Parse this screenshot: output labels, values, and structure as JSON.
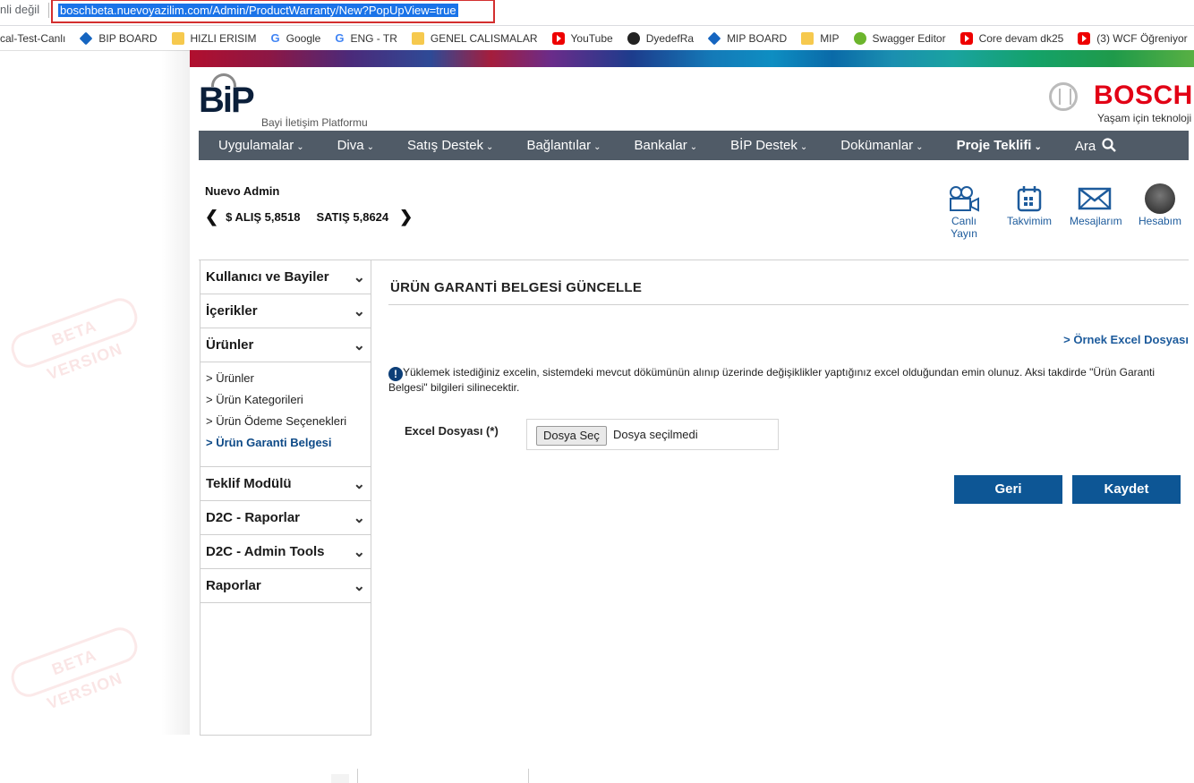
{
  "browser": {
    "secure_text": "nli değil",
    "url": "boschbeta.nuevoyazilim.com/Admin/ProductWarranty/New?PopUpView=true"
  },
  "bookmarks": [
    {
      "label": "cal-Test-Canlı",
      "icon": "none"
    },
    {
      "label": "BIP BOARD",
      "icon": "diamond-icon"
    },
    {
      "label": "HIZLI ERISIM",
      "icon": "folder-icon"
    },
    {
      "label": "Google",
      "icon": "google-icon"
    },
    {
      "label": "ENG - TR",
      "icon": "google-icon"
    },
    {
      "label": "GENEL CALISMALAR",
      "icon": "folder-icon"
    },
    {
      "label": "YouTube",
      "icon": "youtube-icon"
    },
    {
      "label": "DyedefRa",
      "icon": "github-icon"
    },
    {
      "label": "MIP BOARD",
      "icon": "diamond-icon"
    },
    {
      "label": "MIP",
      "icon": "folder-icon"
    },
    {
      "label": "Swagger Editor",
      "icon": "swagger-icon"
    },
    {
      "label": "Core devam dk25",
      "icon": "youtube-icon"
    },
    {
      "label": "(3) WCF Öğreniyor",
      "icon": "youtube-icon"
    }
  ],
  "brand": {
    "logo": "BiP",
    "subtitle": "Bayi İletişim Platformu",
    "bosch_name": "BOSCH",
    "bosch_tagline": "Yaşam için teknoloji"
  },
  "nav": {
    "items": [
      "Uygulamalar",
      "Diva",
      "Satış Destek",
      "Bağlantılar",
      "Bankalar",
      "BİP Destek",
      "Dokümanlar",
      "Proje Teklifi"
    ],
    "search": "Ara"
  },
  "user": {
    "name": "Nuevo Admin",
    "buy": "$ ALIŞ 5,8518",
    "sell": "SATIŞ 5,8624"
  },
  "quick_links": [
    "Canlı Yayın",
    "Takvimim",
    "Mesajlarım",
    "Hesabım"
  ],
  "sidebar": {
    "sections": [
      "Kullanıcı ve Bayiler",
      "İçerikler",
      "Ürünler",
      "Teklif Modülü",
      "D2C - Raporlar",
      "D2C - Admin Tools",
      "Raporlar"
    ],
    "products_sub": [
      "Ürünler",
      "Ürün Kategorileri",
      "Ürün Ödeme Seçenekleri",
      "Ürün Garanti Belgesi"
    ],
    "active_sub": "Ürün Garanti Belgesi"
  },
  "content": {
    "title": "ÜRÜN GARANTİ BELGESİ GÜNCELLE",
    "sample_link": "> Örnek Excel Dosyası",
    "warning": "Yüklemek istediğiniz excelin, sistemdeki mevcut dökümünün alınıp üzerinde değişiklikler yaptığınız excel olduğundan emin olunuz. Aksi takdirde \"Ürün Garanti Belgesi\" bilgileri silinecektir.",
    "file_label": "Excel Dosyası (*)",
    "file_button": "Dosya Seç",
    "file_status": "Dosya seçilmedi",
    "back_button": "Geri",
    "save_button": "Kaydet"
  },
  "watermark": "BETA VERSION"
}
